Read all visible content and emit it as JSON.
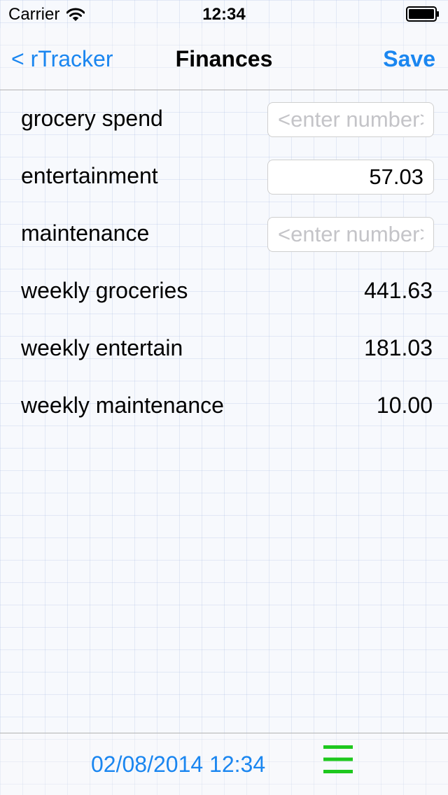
{
  "status_bar": {
    "carrier": "Carrier",
    "time": "12:34",
    "wifi_icon": "wifi-icon",
    "battery_icon": "battery-full-icon"
  },
  "nav": {
    "back_label": "< rTracker",
    "title": "Finances",
    "save_label": "Save",
    "accent_color": "#1a86f0"
  },
  "fields": [
    {
      "label": "grocery spend",
      "value": "",
      "placeholder": "<enter number>"
    },
    {
      "label": "entertainment",
      "value": "57.03",
      "placeholder": "<enter number>"
    },
    {
      "label": "maintenance",
      "value": "",
      "placeholder": "<enter number>"
    }
  ],
  "computed": [
    {
      "label": "weekly groceries",
      "value": "441.63"
    },
    {
      "label": "weekly entertain",
      "value": "181.03"
    },
    {
      "label": "weekly maintenance",
      "value": "10.00"
    }
  ],
  "toolbar": {
    "date": "02/08/2014 12:34",
    "menu_icon": "hamburger-menu-icon",
    "menu_color": "#1ec81e"
  }
}
